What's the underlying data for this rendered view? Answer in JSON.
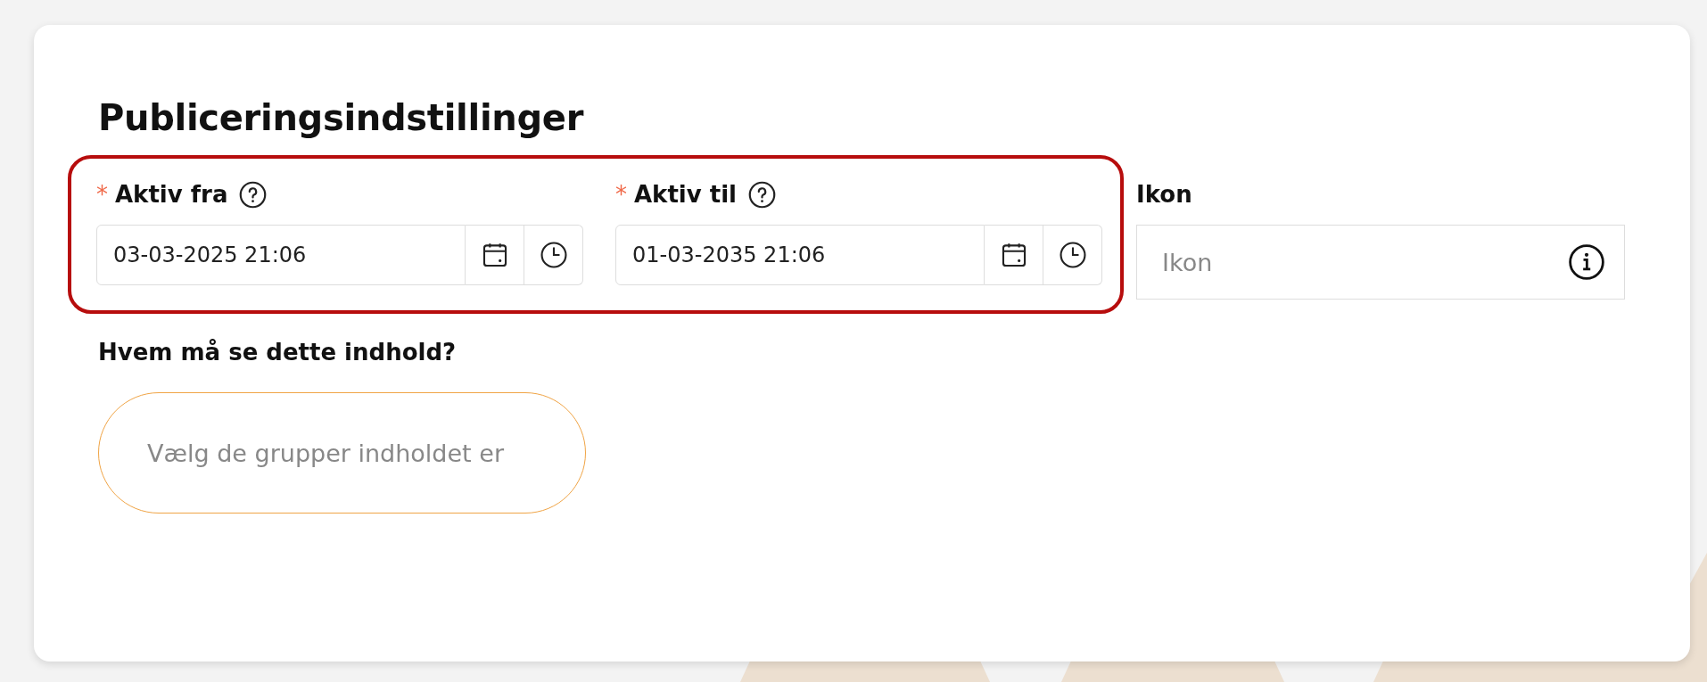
{
  "title": "Publiceringsindstillinger",
  "date_fields": [
    {
      "label": "Aktiv fra",
      "required_mark": "*",
      "value": "03-03-2025 21:06"
    },
    {
      "label": "Aktiv til",
      "required_mark": "*",
      "value": "01-03-2035 21:06"
    }
  ],
  "icon_field": {
    "label": "Ikon",
    "placeholder": "Ikon"
  },
  "audience": {
    "label": "Hvem må se dette indhold?",
    "placeholder": "Vælg de grupper indholdet er"
  }
}
